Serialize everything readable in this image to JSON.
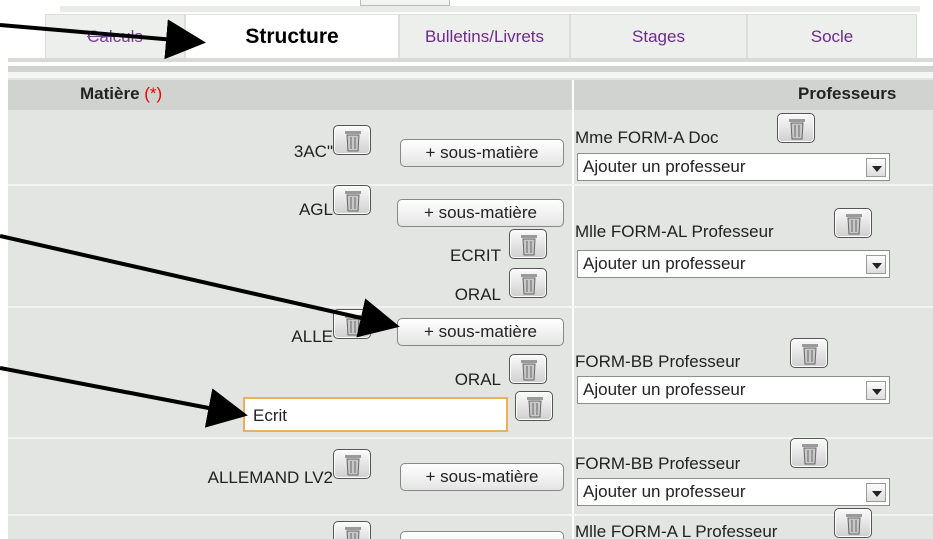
{
  "tabs": [
    "Calculs",
    "Structure",
    "Bulletins/Livrets",
    "Stages",
    "Socle"
  ],
  "header": {
    "matiere": "Matière",
    "required_marker": "(*)",
    "professeurs": "Professeurs"
  },
  "buttons": {
    "add_submatiere": "+ sous-matière"
  },
  "select_placeholder": "Ajouter un professeur",
  "rows": [
    {
      "subject": "3AC\"",
      "professor": "Mme FORM-A Doc"
    },
    {
      "subject": "AGL",
      "professor": "Mlle FORM-AL Professeur",
      "subs": [
        "ECRIT",
        "ORAL"
      ]
    },
    {
      "subject": "ALLE",
      "professor": "FORM-BB Professeur",
      "subs": [
        "ORAL"
      ],
      "new_sub_value": "Ecrit"
    },
    {
      "subject": "ALLEMAND LV2",
      "professor": "FORM-BB Professeur"
    },
    {
      "subject": "",
      "professor": "Mlle FORM-A L Professeur"
    }
  ],
  "icons": {
    "delete": "trash-icon",
    "dropdown": "chevron-down-icon"
  }
}
